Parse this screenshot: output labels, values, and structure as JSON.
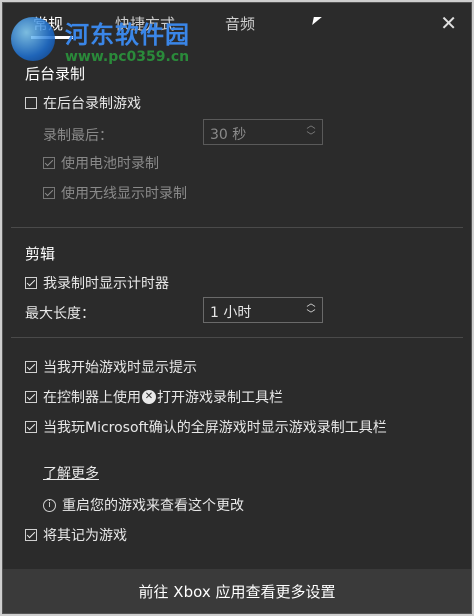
{
  "tabs": [
    "常规",
    "快捷方式",
    "音频"
  ],
  "close": "✕",
  "watermark": {
    "title": "河东软件园",
    "url": "www.pc0359.cn"
  },
  "background_recording": {
    "heading": "后台录制",
    "record_in_background": "在后台录制游戏",
    "record_last_label": "录制最后：",
    "record_last_value": "30 秒",
    "battery": "使用电池时录制",
    "wireless": "使用无线显示时录制"
  },
  "clip": {
    "heading": "剪辑",
    "show_timer": "我录制时显示计时器",
    "max_length_label": "最大长度：",
    "max_length_value": "1 小时"
  },
  "options": {
    "show_tips": "当我开始游戏时显示提示",
    "controller_prefix": "在控制器上使用",
    "controller_suffix": "打开游戏录制工具栏",
    "fullscreen": "当我玩Microsoft确认的全屏游戏时显示游戏录制工具栏"
  },
  "learn_more": "了解更多",
  "restart_note": "重启您的游戏来查看这个更改",
  "remember_game": "将其记为游戏",
  "footer": "前往 Xbox 应用查看更多设置",
  "colors": {
    "panel": "#2b2b2b",
    "footer": "#3a3a3a",
    "text": "#e8e8e8",
    "disabled": "#8a8a8a"
  }
}
